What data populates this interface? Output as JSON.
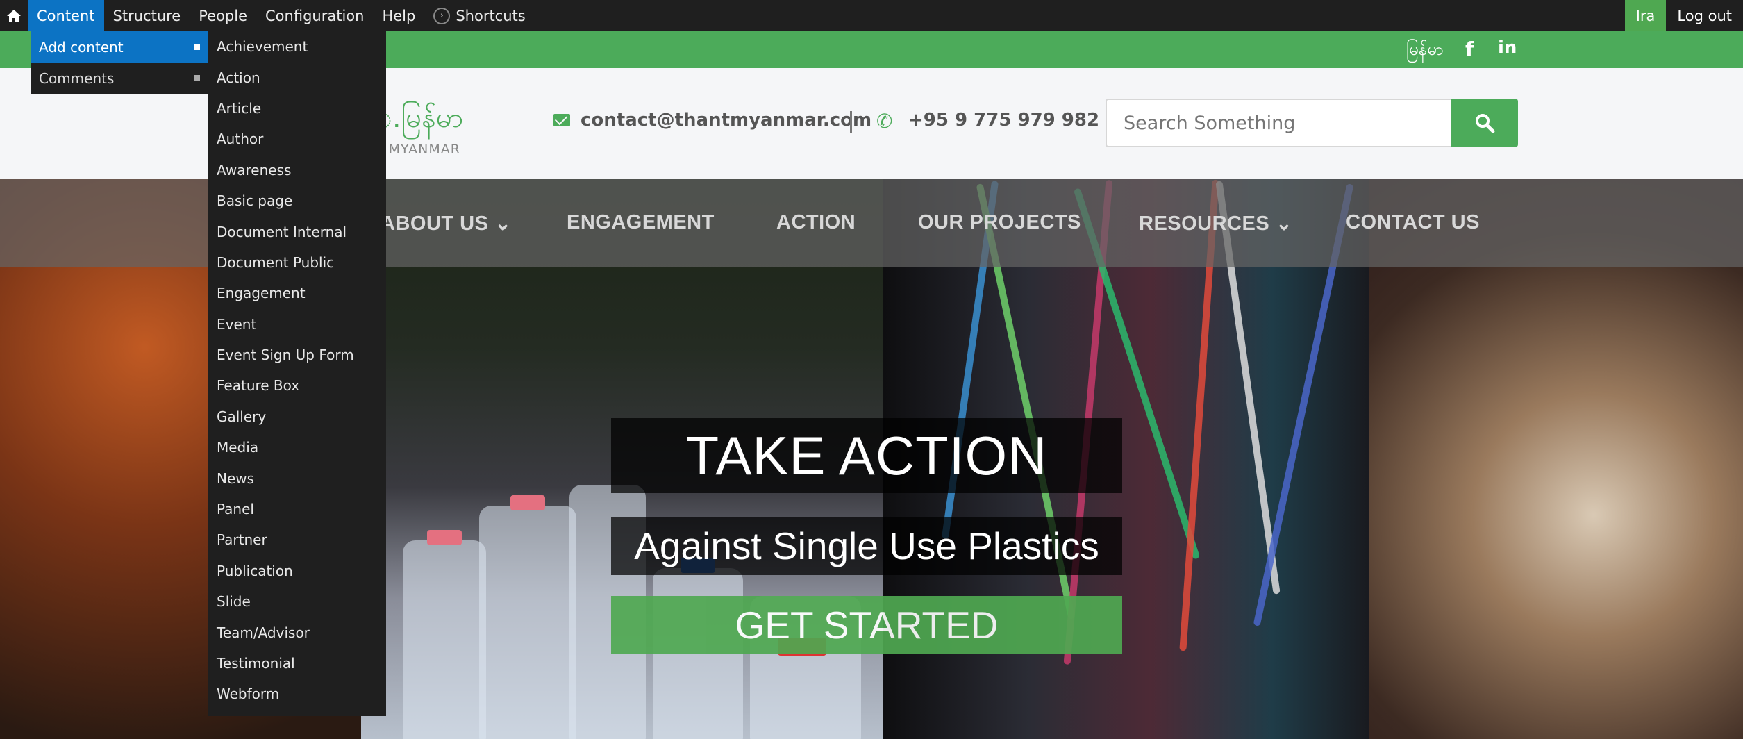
{
  "admin_toolbar": {
    "tabs": [
      "Content",
      "Structure",
      "People",
      "Configuration",
      "Help"
    ],
    "shortcuts_label": "Shortcuts",
    "user_label": "Ira",
    "logout_label": "Log out"
  },
  "content_menu": {
    "level1": [
      {
        "label": "Add content"
      },
      {
        "label": "Comments"
      }
    ],
    "add_content_items": [
      "Achievement",
      "Action",
      "Article",
      "Author",
      "Awareness",
      "Basic page",
      "Document Internal",
      "Document Public",
      "Engagement",
      "Event",
      "Event Sign Up Form",
      "Feature Box",
      "Gallery",
      "Media",
      "News",
      "Panel",
      "Partner",
      "Publication",
      "Slide",
      "Team/Advisor",
      "Testimonial",
      "Webform"
    ]
  },
  "top_strip": {
    "language_label": "မြန်မာ",
    "facebook_glyph": "f",
    "linkedin_glyph": "in"
  },
  "header": {
    "logo_text": "ံ.မြန်မာ",
    "logo_sub": "T MYANMAR",
    "email": "contact@thantmyanmar.com",
    "phone": "+95 9 775 979 982",
    "search_placeholder": "Search Something"
  },
  "nav": {
    "items": [
      "ABOUT US",
      "ENGAGEMENT",
      "ACTION",
      "OUR PROJECTS",
      "RESOURCES",
      "CONTACT US"
    ]
  },
  "hero": {
    "title": "TAKE ACTION",
    "subtitle": "Against Single Use Plastics",
    "cta_label": "GET STARTED"
  },
  "colors": {
    "accent_green": "#4cab5a",
    "admin_active_blue": "#0c73c4",
    "admin_bg": "#1f1f1f"
  }
}
